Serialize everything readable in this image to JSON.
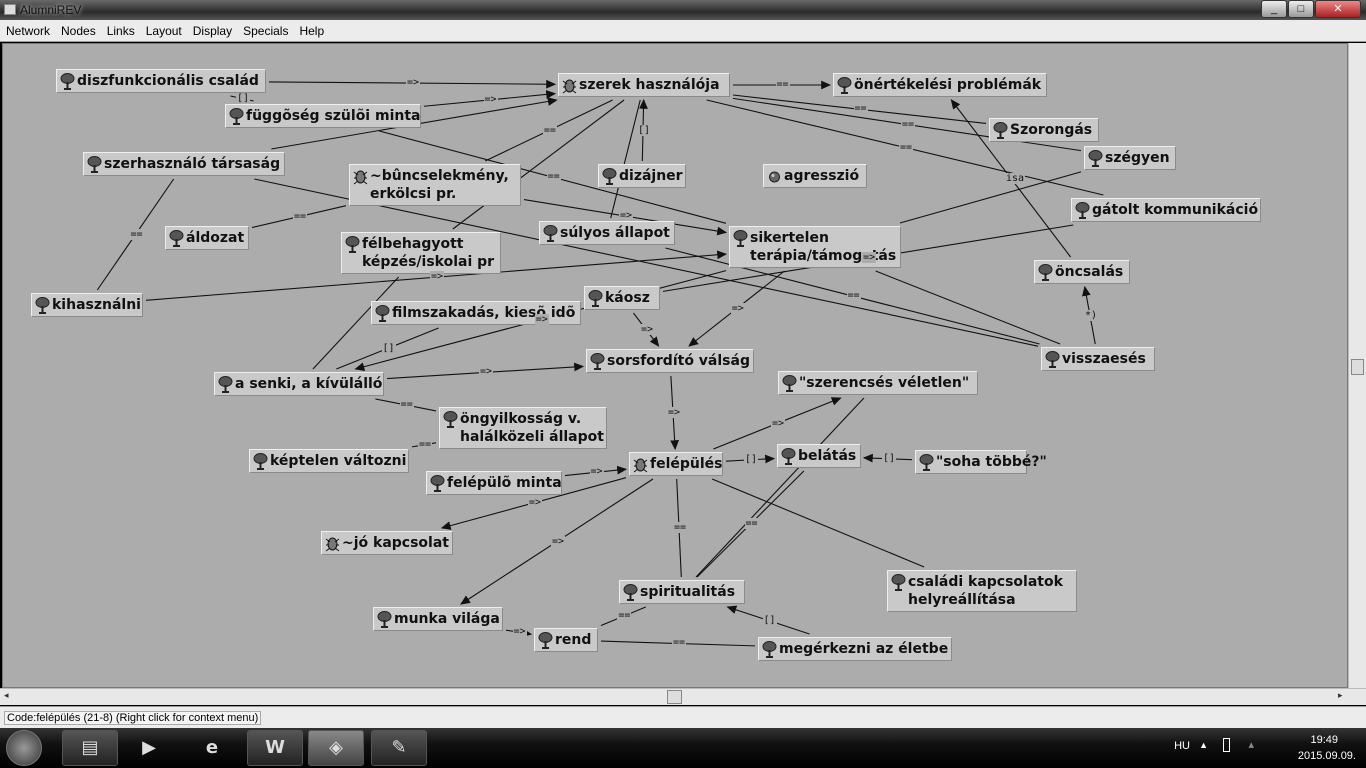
{
  "window": {
    "title": "AlumniREV",
    "buttons": [
      "minimize",
      "maximize",
      "close"
    ]
  },
  "menu": [
    "Network",
    "Nodes",
    "Links",
    "Layout",
    "Display",
    "Specials",
    "Help"
  ],
  "network": {
    "nodes": [
      {
        "id": "n1",
        "label": "diszfunkcionális család",
        "icon": "tree-icon"
      },
      {
        "id": "n2",
        "label": "szerek használója",
        "icon": "bug-icon"
      },
      {
        "id": "n3",
        "label": "önértékelési problémák",
        "icon": "tree-icon"
      },
      {
        "id": "n4",
        "label": "függõség szülõi minta",
        "icon": "tree-icon"
      },
      {
        "id": "n5",
        "label": "szerhasználó társaság",
        "icon": "tree-icon"
      },
      {
        "id": "n6",
        "label": "~bûncselekmény,\nerkölcsi pr.",
        "icon": "bug-icon"
      },
      {
        "id": "n7",
        "label": "dizájner",
        "icon": "tree-icon"
      },
      {
        "id": "n8",
        "label": "agresszió",
        "icon": "dot-icon"
      },
      {
        "id": "n9",
        "label": "Szorongás",
        "icon": "tree-icon"
      },
      {
        "id": "n10",
        "label": "szégyen",
        "icon": "tree-icon"
      },
      {
        "id": "n11",
        "label": "gátolt kommunikáció",
        "icon": "tree-icon"
      },
      {
        "id": "n12",
        "label": "áldozat",
        "icon": "tree-icon"
      },
      {
        "id": "n13",
        "label": "súlyos állapot",
        "icon": "tree-icon"
      },
      {
        "id": "n14",
        "label": "félbehagyott\nképzés/iskolai pr",
        "icon": "tree-icon"
      },
      {
        "id": "n15",
        "label": "sikertelen\nterápia/támogatás",
        "icon": "tree-icon"
      },
      {
        "id": "n16",
        "label": "öncsalás",
        "icon": "tree-icon"
      },
      {
        "id": "n17",
        "label": "kihasználni",
        "icon": "tree-icon"
      },
      {
        "id": "n18",
        "label": "káosz",
        "icon": "tree-icon"
      },
      {
        "id": "n19",
        "label": "filmszakadás, kiesõ idõ",
        "icon": "tree-icon"
      },
      {
        "id": "n20",
        "label": "a senki, a kívülálló",
        "icon": "tree-icon"
      },
      {
        "id": "n21",
        "label": "sorsfordító válság",
        "icon": "tree-icon"
      },
      {
        "id": "n22",
        "label": "visszaesés",
        "icon": "tree-icon"
      },
      {
        "id": "n23",
        "label": "\"szerencsés véletlen\"",
        "icon": "tree-icon"
      },
      {
        "id": "n24",
        "label": "öngyilkosság v.\nhalálközeli állapot",
        "icon": "tree-icon"
      },
      {
        "id": "n25",
        "label": "képtelen változni",
        "icon": "tree-icon"
      },
      {
        "id": "n26",
        "label": "felépülõ minta",
        "icon": "tree-icon"
      },
      {
        "id": "n27",
        "label": "felépülés",
        "icon": "bug-icon"
      },
      {
        "id": "n28",
        "label": "belátás",
        "icon": "tree-icon"
      },
      {
        "id": "n29",
        "label": "\"soha többé?\"",
        "icon": "tree-icon"
      },
      {
        "id": "n30",
        "label": "~jó kapcsolat",
        "icon": "bug-icon"
      },
      {
        "id": "n31",
        "label": "spiritualitás",
        "icon": "tree-icon"
      },
      {
        "id": "n32",
        "label": "családi kapcsolatok\nhelyreállítása",
        "icon": "tree-icon"
      },
      {
        "id": "n33",
        "label": "munka világa",
        "icon": "tree-icon"
      },
      {
        "id": "n34",
        "label": "rend",
        "icon": "tree-icon"
      },
      {
        "id": "n35",
        "label": "megérkezni az életbe",
        "icon": "tree-icon"
      }
    ],
    "links": [
      {
        "from": "n1",
        "to": "n2",
        "label": "=>",
        "arrow": true
      },
      {
        "from": "n4",
        "to": "n2",
        "label": "=>",
        "arrow": true
      },
      {
        "from": "n5",
        "to": "n2",
        "label": "",
        "arrow": true
      },
      {
        "from": "n1",
        "to": "n4",
        "label": "[]",
        "arrow": false
      },
      {
        "from": "n2",
        "to": "n3",
        "label": "==",
        "arrow": true
      },
      {
        "from": "n2",
        "to": "n9",
        "label": "==",
        "arrow": false
      },
      {
        "from": "n2",
        "to": "n10",
        "label": "==",
        "arrow": false
      },
      {
        "from": "n2",
        "to": "n11",
        "label": "==",
        "arrow": false
      },
      {
        "from": "n7",
        "to": "n2",
        "label": "[]",
        "arrow": true
      },
      {
        "from": "n2",
        "to": "n6",
        "label": "==",
        "arrow": false
      },
      {
        "from": "n2",
        "to": "n14",
        "label": "",
        "arrow": false
      },
      {
        "from": "n2",
        "to": "n13",
        "label": "",
        "arrow": false
      },
      {
        "from": "n16",
        "to": "n3",
        "label": "isa",
        "arrow": true
      },
      {
        "from": "n22",
        "to": "n16",
        "label": "*)",
        "arrow": true
      },
      {
        "from": "n4",
        "to": "n15",
        "label": "==",
        "arrow": false
      },
      {
        "from": "n5",
        "to": "n17",
        "label": "==",
        "arrow": false
      },
      {
        "from": "n5",
        "to": "n22",
        "label": "",
        "arrow": false
      },
      {
        "from": "n6",
        "to": "n12",
        "label": "==",
        "arrow": false
      },
      {
        "from": "n6",
        "to": "n15",
        "label": "=>",
        "arrow": true
      },
      {
        "from": "n17",
        "to": "n15",
        "label": "=>",
        "arrow": true
      },
      {
        "from": "n13",
        "to": "n22",
        "label": "==",
        "arrow": false
      },
      {
        "from": "n15",
        "to": "n22",
        "label": "",
        "arrow": false
      },
      {
        "from": "n10",
        "to": "n15",
        "label": "",
        "arrow": false
      },
      {
        "from": "n11",
        "to": "n18",
        "label": "=>",
        "arrow": false
      },
      {
        "from": "n15",
        "to": "n21",
        "label": "=>",
        "arrow": true
      },
      {
        "from": "n18",
        "to": "n21",
        "label": "=>",
        "arrow": true
      },
      {
        "from": "n15",
        "to": "n20",
        "label": "=>",
        "arrow": true
      },
      {
        "from": "n19",
        "to": "n20",
        "label": "[]",
        "arrow": false
      },
      {
        "from": "n14",
        "to": "n20",
        "label": "",
        "arrow": false
      },
      {
        "from": "n20",
        "to": "n21",
        "label": "=>",
        "arrow": true
      },
      {
        "from": "n20",
        "to": "n24",
        "label": "==",
        "arrow": false
      },
      {
        "from": "n25",
        "to": "n24",
        "label": "==",
        "arrow": false
      },
      {
        "from": "n21",
        "to": "n27",
        "label": "=>",
        "arrow": true
      },
      {
        "from": "n26",
        "to": "n27",
        "label": "=>",
        "arrow": true
      },
      {
        "from": "n27",
        "to": "n23",
        "label": "=>",
        "arrow": true
      },
      {
        "from": "n27",
        "to": "n28",
        "label": "[]",
        "arrow": true
      },
      {
        "from": "n29",
        "to": "n28",
        "label": "[]",
        "arrow": true
      },
      {
        "from": "n27",
        "to": "n30",
        "label": "=>",
        "arrow": true
      },
      {
        "from": "n27",
        "to": "n33",
        "label": "=>",
        "arrow": true
      },
      {
        "from": "n27",
        "to": "n31",
        "label": "==",
        "arrow": false
      },
      {
        "from": "n27",
        "to": "n32",
        "label": "",
        "arrow": false
      },
      {
        "from": "n23",
        "to": "n31",
        "label": "",
        "arrow": false
      },
      {
        "from": "n28",
        "to": "n31",
        "label": "==",
        "arrow": false
      },
      {
        "from": "n35",
        "to": "n31",
        "label": "[]",
        "arrow": true
      },
      {
        "from": "n31",
        "to": "n34",
        "label": "==",
        "arrow": false
      },
      {
        "from": "n33",
        "to": "n34",
        "label": "=>",
        "arrow": true
      },
      {
        "from": "n34",
        "to": "n35",
        "label": "==",
        "arrow": false
      }
    ]
  },
  "status": {
    "text": "Code:felépülés (21-8) (Right click for context menu)"
  },
  "taskbar": {
    "apps": [
      "explorer",
      "media-player",
      "internet-explorer",
      "word",
      "alumnirev",
      "paint"
    ],
    "language": "HU",
    "time": "19:49",
    "date": "2015.09.09."
  }
}
